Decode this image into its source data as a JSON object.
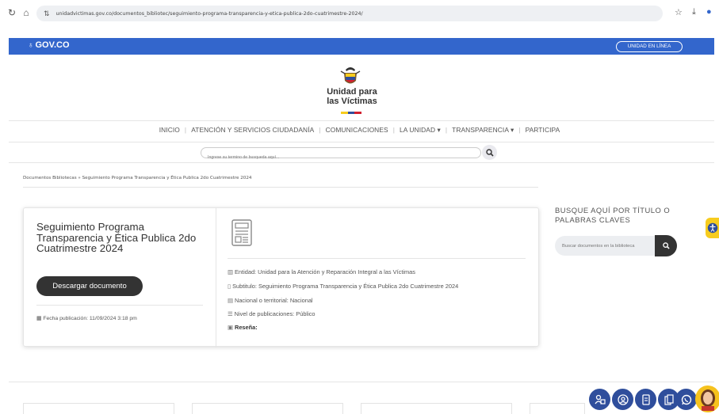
{
  "browser": {
    "url": "unidadvictimas.gov.co/documentos_bibliotec/seguimiento-programa-transparencia-y-etica-publica-2do-cuatrimestre-2024/"
  },
  "gov_bar": {
    "logo_text": "GOV.CO",
    "online_button": "UNIDAD EN LÍNEA",
    "color": "#3366cc"
  },
  "header": {
    "logo_line1": "Unidad para",
    "logo_line2": "las Víctimas",
    "flag_colors": [
      "#f7cc1e",
      "#2f4e9c",
      "#d1202f"
    ]
  },
  "nav": {
    "items": [
      {
        "label": "INICIO"
      },
      {
        "label": "ATENCIÓN Y SERVICIOS CIUDADANÍA"
      },
      {
        "label": "COMUNICACIONES"
      },
      {
        "label": "LA UNIDAD ▾"
      },
      {
        "label": "TRANSPARENCIA ▾"
      },
      {
        "label": "PARTICIPA"
      }
    ]
  },
  "search": {
    "placeholder": "Ingrese su termino de busqueda aquí..."
  },
  "breadcrumb": {
    "text": "Documentos Bibliotecas » Seguimiento Programa Transparencia y Ética Publica 2do Cuatrimestre 2024"
  },
  "document": {
    "title": "Seguimiento Programa Transparencia y Ética Publica 2do Cuatrimestre 2024",
    "download_label": "Descargar documento",
    "pub_date": "Fecha publicación: 11/09/2024 3:18 pm",
    "entidad": "Entidad: Unidad para la Atención y Reparación Integral a las Víctimas",
    "subtitulo": "Subtitulo: Seguimiento Programa Transparencia y Ética Publica 2do Cuatrimestre 2024",
    "nacional": "Nacional o territorial: Nacional",
    "nivel": "Nivel de publicaciones: Público",
    "resena": "Reseña:"
  },
  "sidebar": {
    "title": "BUSQUE AQUÍ POR TÍTULO O PALABRAS CLAVES",
    "search_placeholder": "Buscar documentos en la biblioteca"
  },
  "colors": {
    "accent": "#3366cc",
    "button_dark": "#333333",
    "accessibility": "#f7cc1e",
    "float_icons": "#2f4e9c"
  }
}
